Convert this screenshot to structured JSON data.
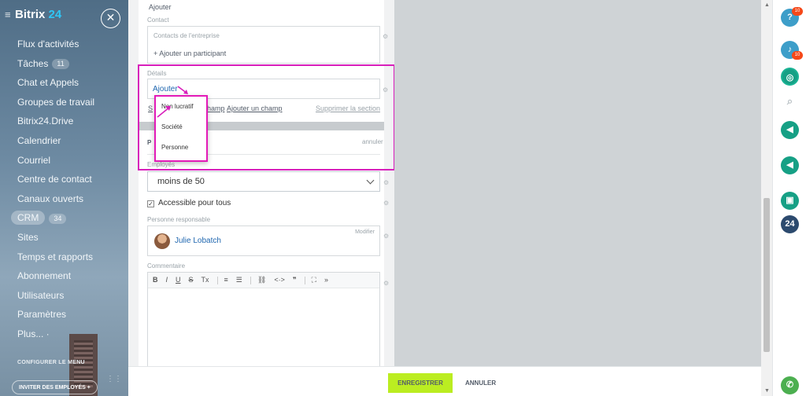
{
  "sidebar": {
    "logo_text": "Bitrix",
    "logo_num": "24",
    "items": [
      {
        "label": "Flux d'activités",
        "count": ""
      },
      {
        "label": "Tâches",
        "count": "11"
      },
      {
        "label": "Chat et Appels",
        "count": ""
      },
      {
        "label": "Groupes de travail",
        "count": ""
      },
      {
        "label": "Bitrix24.Drive",
        "count": ""
      },
      {
        "label": "Calendrier",
        "count": ""
      },
      {
        "label": "Courriel",
        "count": ""
      },
      {
        "label": "Centre de contact",
        "count": ""
      },
      {
        "label": "Canaux ouverts",
        "count": ""
      },
      {
        "label": "CRM",
        "count": "34",
        "active": true
      },
      {
        "label": "Sites",
        "count": ""
      },
      {
        "label": "Temps et rapports",
        "count": ""
      },
      {
        "label": "Abonnement",
        "count": ""
      },
      {
        "label": "Utilisateurs",
        "count": ""
      },
      {
        "label": "Paramètres",
        "count": ""
      },
      {
        "label": "Plus... ·",
        "count": ""
      }
    ],
    "configure_menu": "CONFIGURER LE MENU",
    "invite_employees": "INVITER DES EMPLOYÉS",
    "invite_plus": "+"
  },
  "form": {
    "top_add": "Ajouter",
    "contact_label": "Contact",
    "contacts_company": "Contacts de l'entreprise",
    "add_participant": "+ Ajouter un participant",
    "details_label": "Détails",
    "details_add": "Ajouter",
    "field_select_partial": "S",
    "field_champ_partial": "hamp",
    "add_field": "Ajouter un champ",
    "delete_section": "Supprimer la section",
    "p_partial": "P",
    "cancel_small": "annuler",
    "employees_label": "Employés",
    "employees_value": "moins de 50",
    "accessible_label": "Accessible pour tous",
    "responsible_label": "Personne responsable",
    "modify": "Modifier",
    "responsible_name": "Julie Lobatch",
    "comment_label": "Commentaire",
    "toolbar": [
      "B",
      "I",
      "U",
      "S",
      "Tx",
      "≡",
      "☰",
      "⛓",
      "<·>",
      "❞",
      "⛶",
      "»"
    ]
  },
  "dropdown": {
    "options": [
      "Non lucratif",
      "Société",
      "Personne"
    ]
  },
  "bottom": {
    "save": "ENREGISTRER",
    "cancel": "ANNULER"
  },
  "rightbar": {
    "help_badge": "10",
    "notif_badge": "10",
    "b24": "24"
  },
  "colors": {
    "accent_green": "#bbed21",
    "highlight_magenta": "#d81fbb",
    "link_blue": "#2067b0"
  }
}
